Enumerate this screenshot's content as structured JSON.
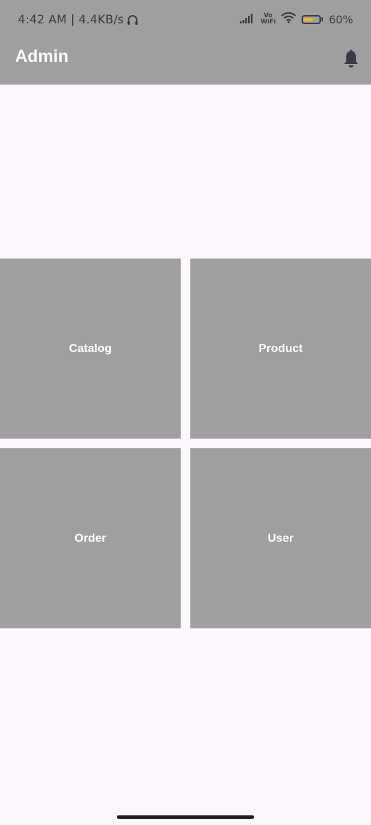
{
  "status_bar": {
    "time_speed": "4:42 AM | 4.4KB/s",
    "vowifi_top": "Vo",
    "vowifi_bottom": "WiFi",
    "battery_percent": "60%",
    "battery_level": 0.6,
    "battery_color": "#f0b429"
  },
  "app_bar": {
    "title": "Admin",
    "bell_icon": "notification-bell-icon",
    "background": "#a09fa0"
  },
  "tiles": [
    {
      "label": "Catalog"
    },
    {
      "label": "Product"
    },
    {
      "label": "Order"
    },
    {
      "label": "User"
    }
  ],
  "colors": {
    "tile": "#a09fa0",
    "page_background": "#fdf8fd",
    "text_on_tile": "#ffffff"
  }
}
